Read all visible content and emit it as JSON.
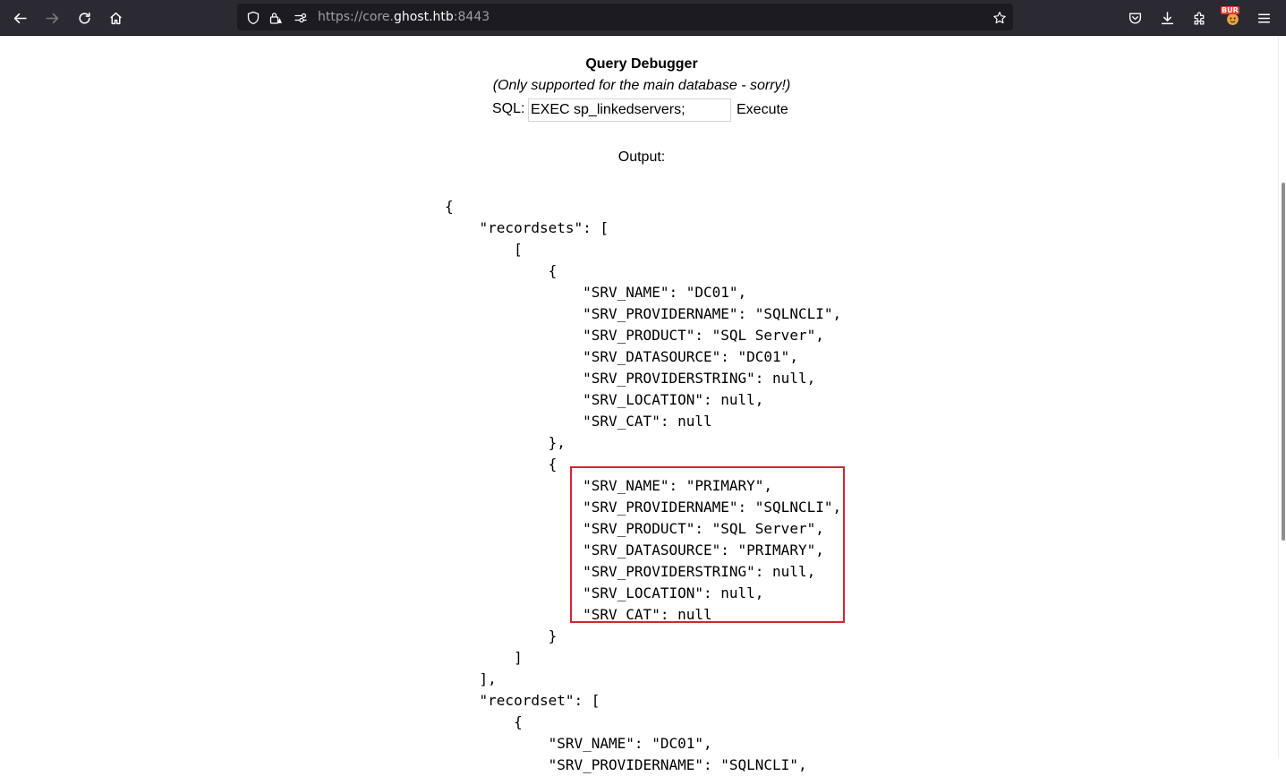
{
  "browser": {
    "url_prefix": "https://core.",
    "url_host": "ghost.htb",
    "url_suffix": ":8443",
    "extension_badge": "BUR"
  },
  "page": {
    "title": "Query Debugger",
    "subtitle": "(Only supported for the main database - sorry!)",
    "sql_label": "SQL:",
    "sql_value": "EXEC sp_linkedservers;",
    "execute_label": "Execute",
    "output_label": "Output:"
  },
  "output_lines": [
    "{",
    "    \"recordsets\": [",
    "        [",
    "            {",
    "                \"SRV_NAME\": \"DC01\",",
    "                \"SRV_PROVIDERNAME\": \"SQLNCLI\",",
    "                \"SRV_PRODUCT\": \"SQL Server\",",
    "                \"SRV_DATASOURCE\": \"DC01\",",
    "                \"SRV_PROVIDERSTRING\": null,",
    "                \"SRV_LOCATION\": null,",
    "                \"SRV_CAT\": null",
    "            },",
    "            {",
    "                \"SRV_NAME\": \"PRIMARY\",",
    "                \"SRV_PROVIDERNAME\": \"SQLNCLI\",",
    "                \"SRV_PRODUCT\": \"SQL Server\",",
    "                \"SRV_DATASOURCE\": \"PRIMARY\",",
    "                \"SRV_PROVIDERSTRING\": null,",
    "                \"SRV_LOCATION\": null,",
    "                \"SRV_CAT\": null",
    "            }",
    "        ]",
    "    ],",
    "    \"recordset\": [",
    "        {",
    "            \"SRV_NAME\": \"DC01\",",
    "            \"SRV_PROVIDERNAME\": \"SQLNCLI\","
  ],
  "colors": {
    "toolbar_bg": "#2b2a33",
    "urlbar_bg": "#1c1b22",
    "highlight_border": "#d22631"
  },
  "icons": {
    "back": "arrow-left-icon",
    "forward": "arrow-right-icon",
    "reload": "reload-icon",
    "home": "home-icon",
    "tracking": "shield-icon",
    "lock": "lock-warning-icon",
    "permissions": "permissions-icon",
    "bookmark": "star-icon",
    "pocket": "pocket-icon",
    "downloads": "download-icon",
    "extensions": "puzzle-icon",
    "burp": "burp-extension-icon",
    "menu": "hamburger-menu-icon"
  }
}
